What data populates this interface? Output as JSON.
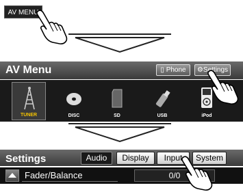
{
  "step1": {
    "av_menu_button": "AV MENU"
  },
  "av_menu": {
    "title": "AV Menu",
    "phone_button": "Phone",
    "settings_button": "Settings",
    "sources": [
      {
        "label": "TUNER",
        "icon": "radio-tower-icon"
      },
      {
        "label": "DISC",
        "icon": "disc-icon"
      },
      {
        "label": "SD",
        "icon": "sd-card-icon"
      },
      {
        "label": "USB",
        "icon": "usb-drive-icon"
      },
      {
        "label": "iPod",
        "icon": "ipod-icon"
      }
    ]
  },
  "settings": {
    "title": "Settings",
    "tabs": [
      "Audio",
      "Display",
      "Input",
      "System"
    ],
    "row": {
      "label": "Fader/Balance",
      "value": "0/0"
    }
  },
  "colors": {
    "tuner_label": "#f6c400",
    "bar_dark": "#3a3a3a"
  }
}
